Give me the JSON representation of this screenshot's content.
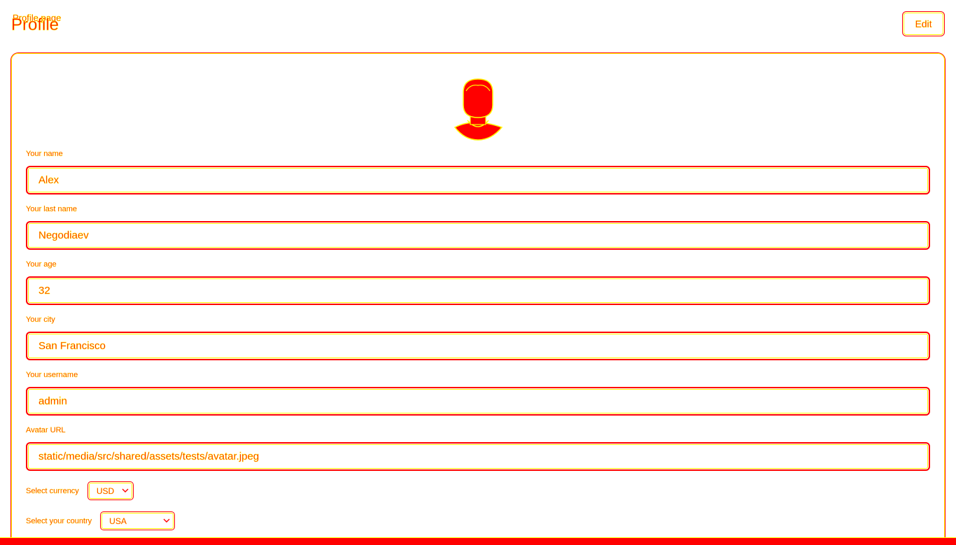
{
  "header": {
    "caption": "Profile page",
    "title": "Profile",
    "edit_label": "Edit"
  },
  "avatar": {
    "icon": "user-avatar-icon"
  },
  "form": {
    "name": {
      "label": "Your name",
      "value": "Alex"
    },
    "lastname": {
      "label": "Your last name",
      "value": "Negodiaev"
    },
    "age": {
      "label": "Your age",
      "value": "32"
    },
    "city": {
      "label": "Your city",
      "value": "San Francisco"
    },
    "username": {
      "label": "Your username",
      "value": "admin"
    },
    "avatar_url": {
      "label": "Avatar URL",
      "value": "static/media/src/shared/assets/tests/avatar.jpeg"
    },
    "currency": {
      "label": "Select currency",
      "value": "USD"
    },
    "country": {
      "label": "Select your country",
      "value": "USA"
    }
  },
  "colors": {
    "primary": "#ff0000",
    "outline": "#ffff00",
    "background": "#ffffff"
  }
}
